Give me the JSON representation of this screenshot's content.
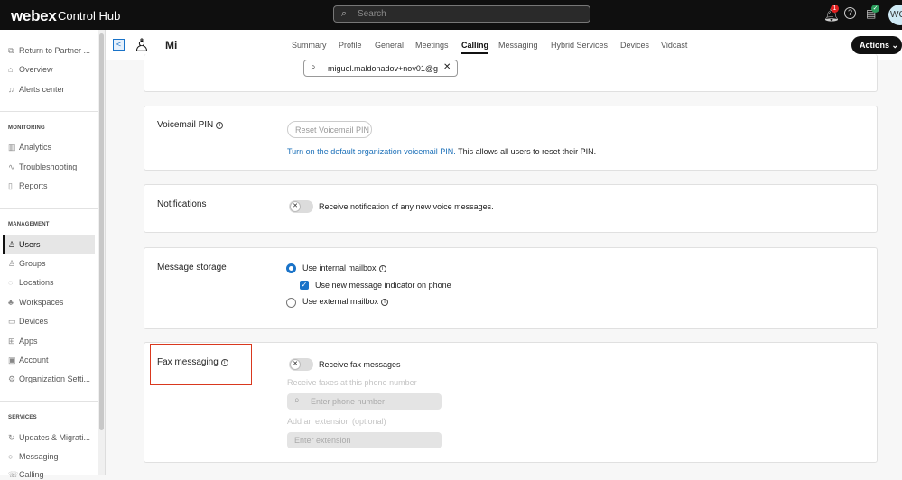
{
  "topbar": {
    "brand": "webex",
    "product": "Control Hub",
    "search_placeholder": "Search",
    "notifications_count": "1",
    "avatar_initials": "WC"
  },
  "sidebar": {
    "top": [
      {
        "label": "Return to Partner ...",
        "icon": "external-link-icon"
      },
      {
        "label": "Overview",
        "icon": "home-icon"
      },
      {
        "label": "Alerts center",
        "icon": "bell-icon"
      }
    ],
    "monitoring_title": "MONITORING",
    "monitoring": [
      {
        "label": "Analytics",
        "icon": "chart-icon"
      },
      {
        "label": "Troubleshooting",
        "icon": "pulse-icon"
      },
      {
        "label": "Reports",
        "icon": "report-icon"
      }
    ],
    "management_title": "MANAGEMENT",
    "management": [
      {
        "label": "Users",
        "icon": "user-icon",
        "active": true
      },
      {
        "label": "Groups",
        "icon": "group-icon"
      },
      {
        "label": "Locations",
        "icon": "location-icon"
      },
      {
        "label": "Workspaces",
        "icon": "workspace-icon"
      },
      {
        "label": "Devices",
        "icon": "device-icon"
      },
      {
        "label": "Apps",
        "icon": "apps-icon"
      },
      {
        "label": "Account",
        "icon": "account-icon"
      },
      {
        "label": "Organization Setti...",
        "icon": "gear-icon"
      }
    ],
    "services_title": "SERVICES",
    "services": [
      {
        "label": "Updates & Migrati...",
        "icon": "refresh-icon"
      },
      {
        "label": "Messaging",
        "icon": "chat-icon"
      },
      {
        "label": "Calling",
        "icon": "phone-icon"
      }
    ]
  },
  "header": {
    "user_name": "Mi",
    "tabs": [
      "Summary",
      "Profile",
      "General",
      "Meetings",
      "Calling",
      "Messaging",
      "Hybrid Services",
      "Devices",
      "Vidcast"
    ],
    "active_tab": "Calling",
    "actions_label": "Actions"
  },
  "main": {
    "search_value": "miguel.maldonadov+nov01@g",
    "voicemail_pin": {
      "title": "Voicemail PIN",
      "button": "Reset Voicemail PIN",
      "link": "Turn on the default organization voicemail PIN.",
      "text": " This allows all users to reset their PIN."
    },
    "notifications": {
      "title": "Notifications",
      "toggle_label": "Receive notification of any new voice messages.",
      "enabled": false
    },
    "message_storage": {
      "title": "Message storage",
      "option_internal": "Use internal mailbox",
      "checkbox_label": "Use new message indicator on phone",
      "option_external": "Use external mailbox",
      "selected": "internal",
      "indicator_checked": true
    },
    "fax": {
      "title": "Fax messaging",
      "toggle_label": "Receive fax messages",
      "enabled": false,
      "phone_label": "Receive faxes at this phone number",
      "phone_placeholder": "Enter phone number",
      "ext_label": "Add an extension (optional)",
      "ext_placeholder": "Enter extension"
    }
  },
  "colors": {
    "accent": "#1a73c8",
    "highlight_box": "#d9381e",
    "topbar": "#0f0f0f"
  }
}
